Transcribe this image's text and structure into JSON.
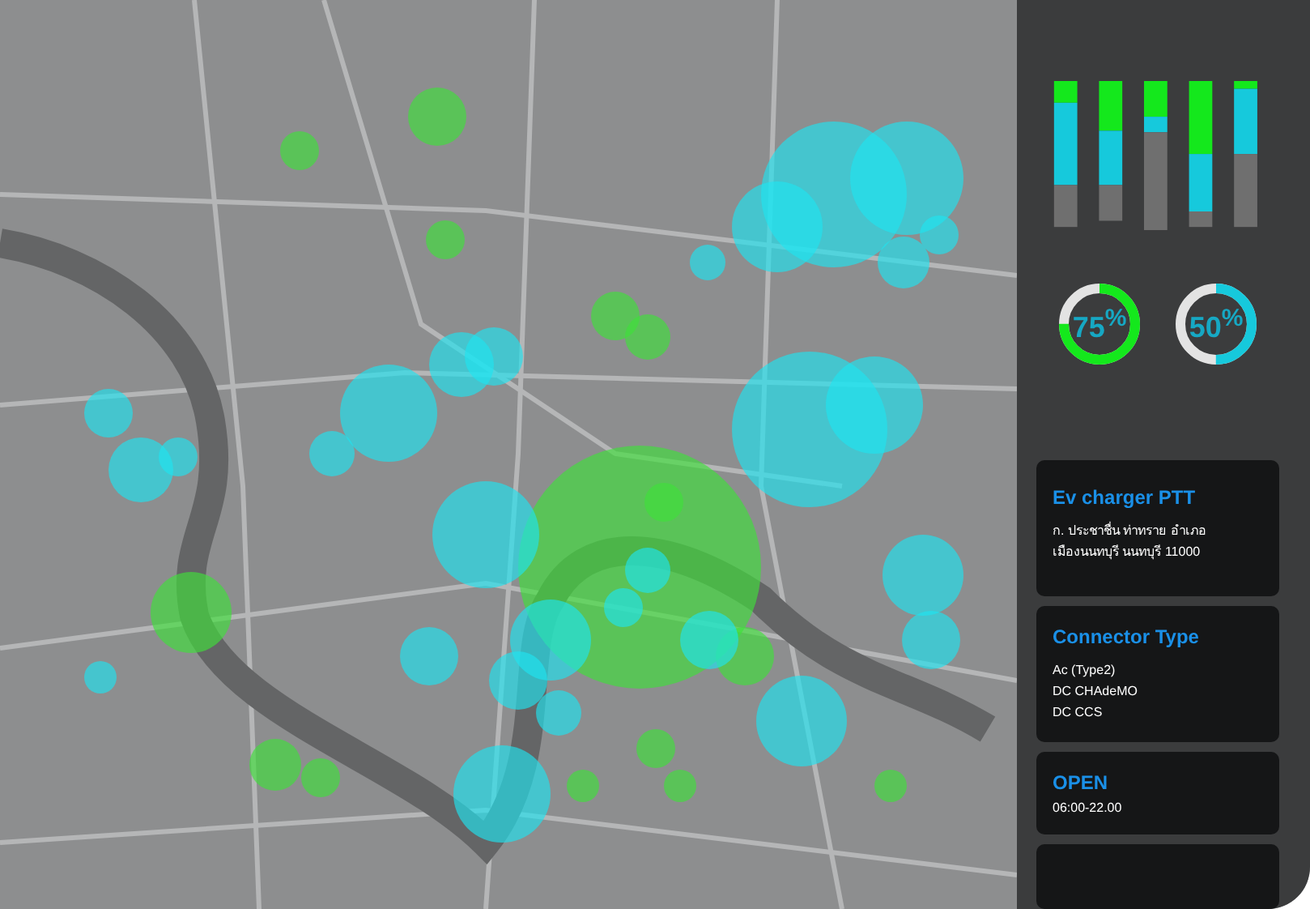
{
  "gauges": [
    {
      "label": "75$^{%}$",
      "level": 0.75,
      "color": "#14e81c"
    },
    {
      "label": "50$^{%}$",
      "level": 0.5,
      "color": "#16c9dc"
    }
  ],
  "cards": [
    {
      "kind": "address",
      "title": "Ev charger  PTT",
      "lines": [
        "ก. ประชาชื่น ท่าทราย อำเภอเมืองนนทบุรี นนทบุรี 11000"
      ]
    },
    {
      "kind": "list",
      "title": "Connector Type",
      "lines": [
        "Ac (Type2)",
        "DC CHAdeMO",
        "DC CCS"
      ]
    },
    {
      "kind": "hours",
      "title": "OPEN",
      "lines": [
        "06:00-22.00"
      ]
    },
    {
      "kind": "empty"
    }
  ]
}
